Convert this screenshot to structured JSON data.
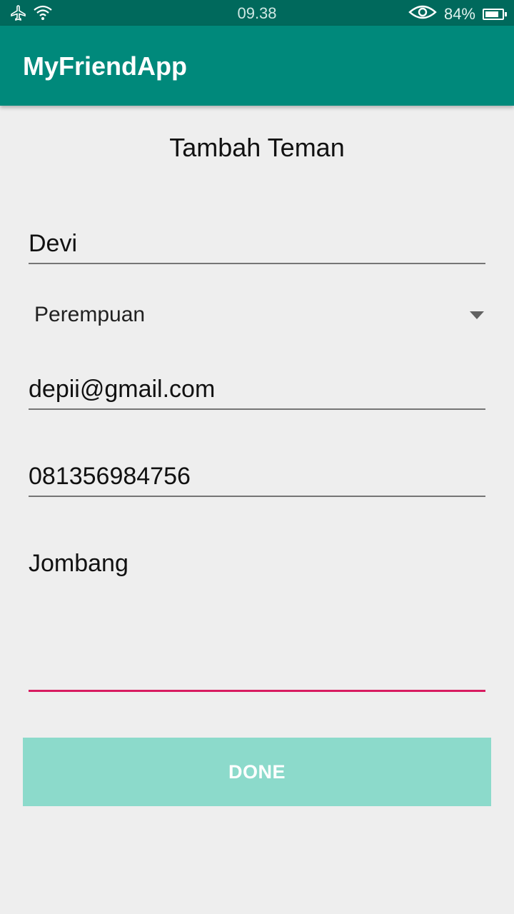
{
  "status_bar": {
    "time": "09.38",
    "battery_percent": "84%",
    "battery_level": 0.84,
    "icons": [
      "airplane-icon",
      "wifi-icon",
      "eye-icon",
      "battery-icon"
    ]
  },
  "app_bar": {
    "title": "MyFriendApp"
  },
  "form": {
    "title": "Tambah Teman",
    "name_value": "Devi",
    "gender_selected": "Perempuan",
    "email_value": "depii@gmail.com",
    "phone_value": "081356984756",
    "address_value": "Jombang",
    "done_label": "DONE"
  },
  "colors": {
    "status_bar": "#00695c",
    "app_bar": "#00897b",
    "accent": "#d81b60",
    "button": "#8cdacb"
  }
}
